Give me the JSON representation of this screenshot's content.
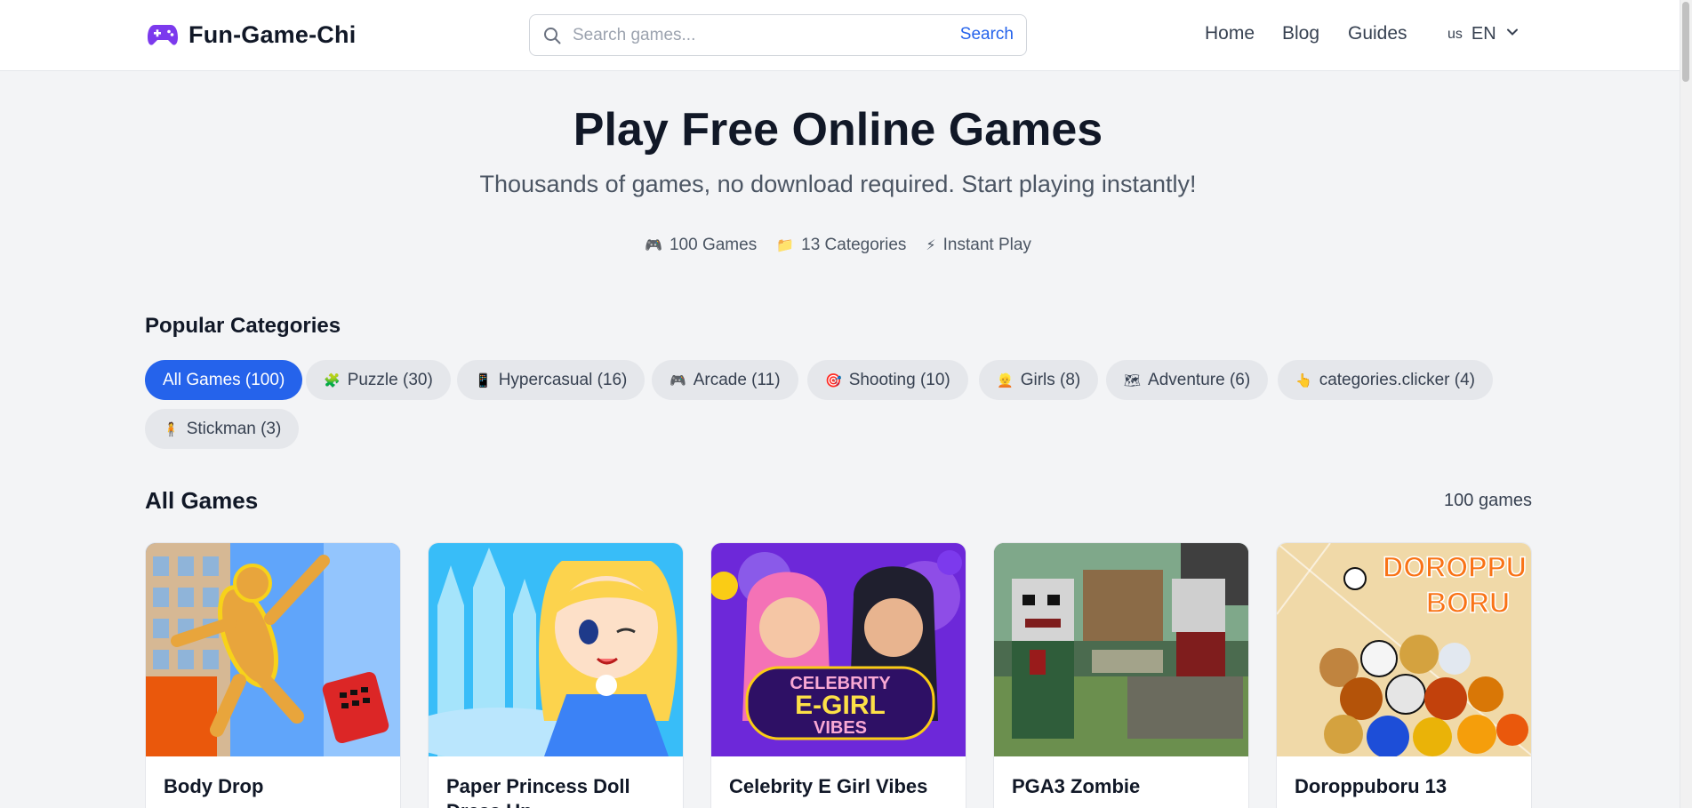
{
  "header": {
    "logo_text": "Fun-Game-Chi",
    "logo_icon": "gamepad-icon",
    "search_placeholder": "Search games...",
    "search_button": "Search",
    "nav": [
      "Home",
      "Blog",
      "Guides"
    ],
    "lang_flag": "us",
    "lang_code": "EN"
  },
  "hero": {
    "title": "Play Free Online Games",
    "subtitle": "Thousands of games, no download required. Start playing instantly!",
    "stats": [
      {
        "icon": "🎮",
        "label": "100 Games"
      },
      {
        "icon": "📁",
        "label": "13 Categories"
      },
      {
        "icon": "⚡",
        "label": "Instant Play"
      }
    ]
  },
  "categories": {
    "title": "Popular Categories",
    "items": [
      {
        "icon": "",
        "label": "All Games (100)",
        "active": true
      },
      {
        "icon": "🧩",
        "label": "Puzzle (30)"
      },
      {
        "icon": "📱",
        "label": "Hypercasual (16)"
      },
      {
        "icon": "🎮",
        "label": "Arcade (11)"
      },
      {
        "icon": "🎯",
        "label": "Shooting (10)"
      },
      {
        "icon": "👱",
        "label": "Girls (8)"
      },
      {
        "icon": "🗺",
        "label": "Adventure (6)"
      },
      {
        "icon": "👆",
        "label": "categories.clicker (4)"
      },
      {
        "icon": "🧍",
        "label": "Stickman (3)"
      }
    ]
  },
  "games": {
    "title": "All Games",
    "count": "100 games",
    "items": [
      {
        "title": "Body Drop"
      },
      {
        "title": "Paper Princess Doll Dress Up"
      },
      {
        "title": "Celebrity E Girl Vibes",
        "banner": [
          "CELEBRITY",
          "E-GIRL",
          "VIBES"
        ]
      },
      {
        "title": "PGA3 Zombie"
      },
      {
        "title": "Doroppuboru 13",
        "banner": [
          "DOROPPU",
          "BORU"
        ]
      }
    ]
  },
  "colors": {
    "accent": "#2563eb",
    "background": "#f3f4f6",
    "pill": "#e5e7eb"
  }
}
